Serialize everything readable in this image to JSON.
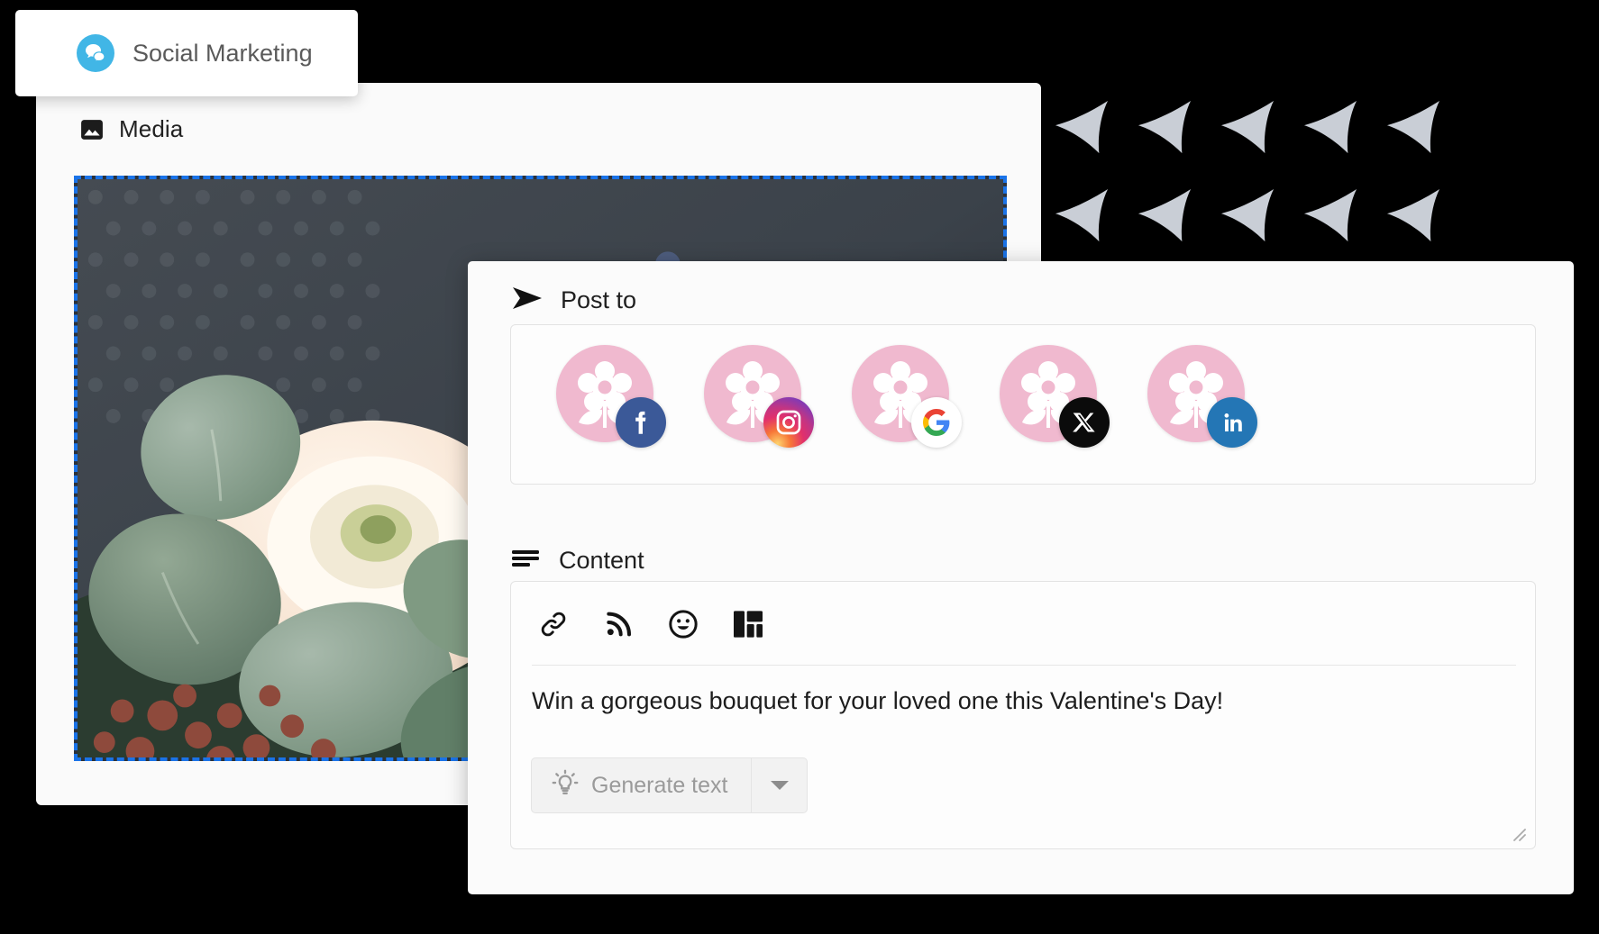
{
  "app": {
    "brand_label": "Social Marketing",
    "brand_icon": "chat-bubble-icon",
    "brand_color": "#41b6e6"
  },
  "media_panel": {
    "section_label": "Media",
    "section_icon": "image-icon",
    "selection_border_color": "#1a73e8",
    "image_alt": "Pastel bouquet of ranunculus, roses and eucalyptus on a dark slate background"
  },
  "post_panel": {
    "post_to": {
      "label": "Post to",
      "icon": "send-arrow-icon",
      "accounts": [
        {
          "name": "facebook-account",
          "network": "Facebook",
          "badge_icon": "facebook-icon",
          "badge_color": "#3b5998",
          "avatar_icon": "flower-icon",
          "avatar_color": "#f0b9cf"
        },
        {
          "name": "instagram-account",
          "network": "Instagram",
          "badge_icon": "instagram-icon",
          "badge_color": "#e1306c",
          "avatar_icon": "flower-icon",
          "avatar_color": "#f0b9cf"
        },
        {
          "name": "google-account",
          "network": "Google Business",
          "badge_icon": "google-icon",
          "badge_color": "#ffffff",
          "avatar_icon": "flower-icon",
          "avatar_color": "#f0b9cf"
        },
        {
          "name": "x-account",
          "network": "X",
          "badge_icon": "x-twitter-icon",
          "badge_color": "#0b0b0b",
          "avatar_icon": "flower-icon",
          "avatar_color": "#f0b9cf"
        },
        {
          "name": "linkedin-account",
          "network": "LinkedIn",
          "badge_icon": "linkedin-icon",
          "badge_color": "#2476b5",
          "avatar_icon": "flower-icon",
          "avatar_color": "#f0b9cf"
        }
      ]
    },
    "content": {
      "label": "Content",
      "icon": "text-lines-icon",
      "toolbar": [
        {
          "name": "insert-link-button",
          "icon": "link-icon"
        },
        {
          "name": "insert-feed-button",
          "icon": "rss-icon"
        },
        {
          "name": "insert-emoji-button",
          "icon": "emoji-smile-icon"
        },
        {
          "name": "insert-layout-button",
          "icon": "layout-grid-icon"
        }
      ],
      "post_text": "Win a gorgeous bouquet for your loved one this Valentine's Day!",
      "generate_button": {
        "label": "Generate text",
        "icon": "lightbulb-icon",
        "caret_icon": "chevron-down-icon"
      },
      "resize_handle_icon": "resize-grip-icon"
    }
  },
  "decoration": {
    "arrow_icon": "cursor-arrow-icon",
    "arrow_color": "#c9ced6",
    "rows": 2,
    "columns": 5
  }
}
